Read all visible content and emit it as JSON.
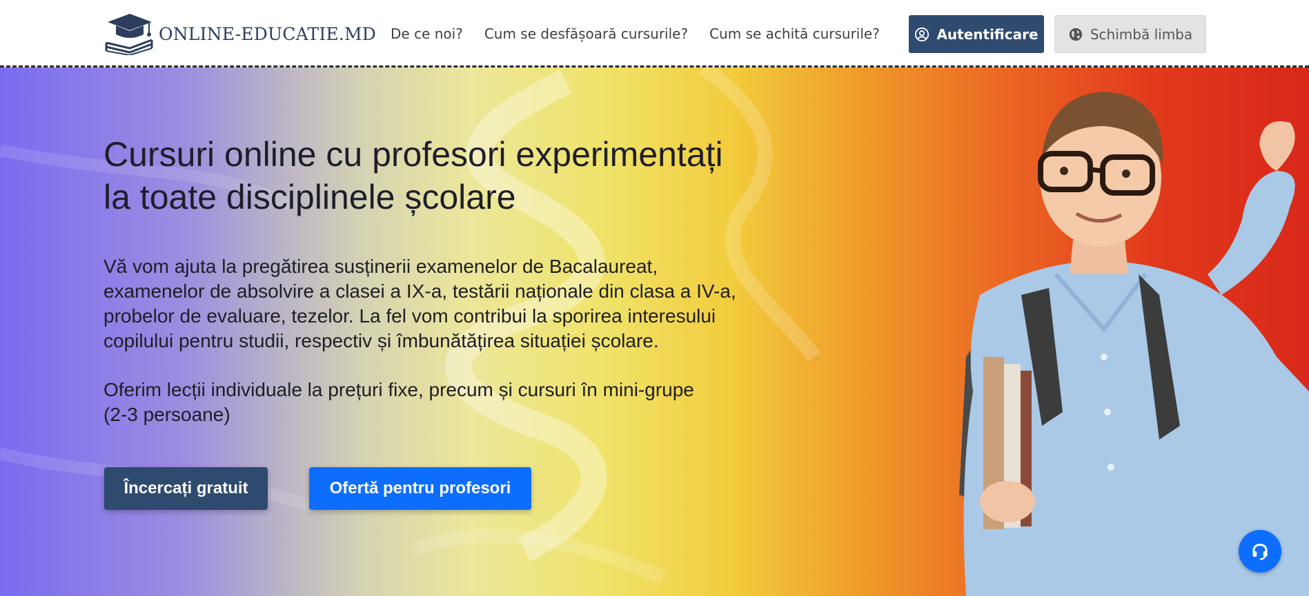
{
  "header": {
    "logo_text": "ONLINE-EDUCATIE.MD",
    "nav": [
      {
        "label": "De ce noi?"
      },
      {
        "label": "Cum se desfășoară cursurile?"
      },
      {
        "label": "Cum se achită cursurile?"
      }
    ],
    "login_label": "Autentificare",
    "language_label": "Schimbă limba"
  },
  "hero": {
    "title_line1": "Cursuri online cu profesori experimentați",
    "title_line2": "la toate disciplinele școlare",
    "description_lines": [
      "Vă vom ajuta la pregătirea susținerii examenelor de Bacalaureat,",
      "examenelor de absolvire a clasei a IX-a, testării naționale din clasa a IV-a,",
      "probelor de evaluare, tezelor. La fel vom contribui la sporirea interesului",
      "copilului pentru studii, respectiv și îmbunătățirea situației școlare."
    ],
    "offer_lines": [
      "Oferim lecții individuale la prețuri fixe, precum și cursuri în mini-grupe",
      "(2-3 persoane)"
    ],
    "try_free_label": "Încercați gratuit",
    "teachers_offer_label": "Ofertă pentru profesori"
  },
  "icons": {
    "logo": "graduation-cap-books-icon",
    "login": "user-circle-icon",
    "language": "globe-icon",
    "support": "headset-icon"
  },
  "colors": {
    "primary_dark": "#2e4a6e",
    "primary_blue": "#0d6efd",
    "logo_text": "#2c3e5c"
  }
}
